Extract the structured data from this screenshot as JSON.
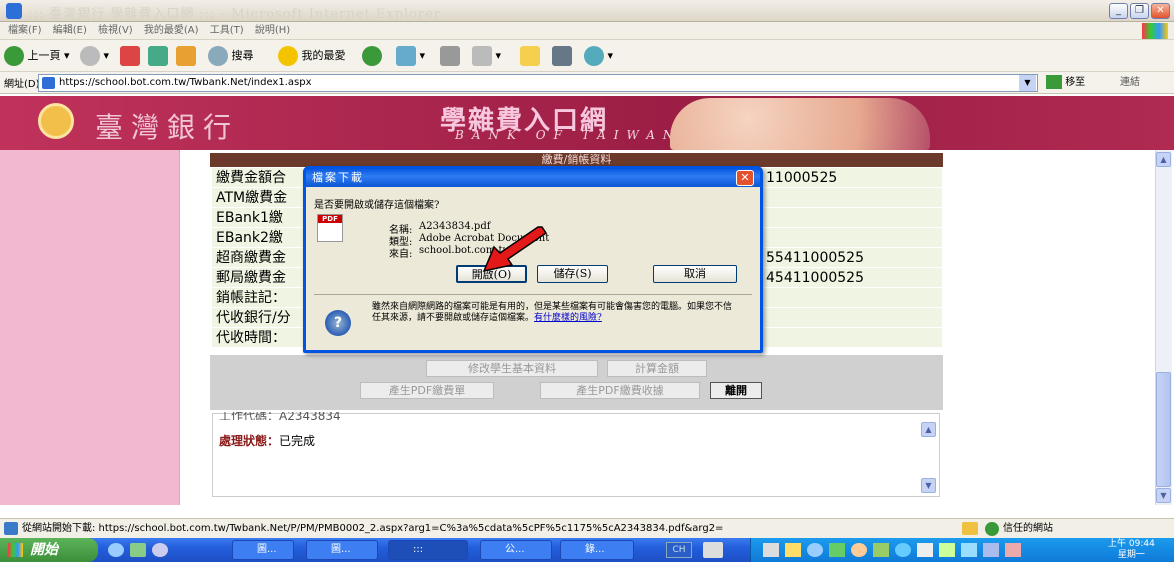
{
  "window": {
    "title": "::: 臺灣銀行 學雜費入口網 ::: - Microsoft Internet Explorer"
  },
  "menu": [
    "檔案(F)",
    "編輯(E)",
    "檢視(V)",
    "我的最愛(A)",
    "工具(T)",
    "說明(H)"
  ],
  "toolbar": {
    "back": "上一頁",
    "search": "搜尋",
    "favorites": "我的最愛"
  },
  "address": {
    "label": "網址(D)",
    "url": "https://school.bot.com.tw/Twbank.Net/index1.aspx",
    "go": "移至",
    "links": "連結"
  },
  "banner": {
    "bank_name": "臺灣銀行",
    "site_title": "學雜費入口網",
    "site_subtitle": "BANK OF TAIWAN"
  },
  "fee_panel": {
    "header": "繳費/銷帳資料",
    "rows": [
      {
        "label": "繳費金額合",
        "value": "11000525"
      },
      {
        "label": "ATM繳費金",
        "value": ""
      },
      {
        "label": "EBank1繳",
        "value": ""
      },
      {
        "label": "EBank2繳",
        "value": ""
      },
      {
        "label": "超商繳費金",
        "value": "55411000525"
      },
      {
        "label": "郵局繳費金",
        "value": "45411000525"
      },
      {
        "label": "銷帳註記：",
        "value": ""
      },
      {
        "label": "代收銀行/分",
        "value": ""
      },
      {
        "label": "代收時間：",
        "value": ""
      }
    ]
  },
  "buttons": {
    "edit_student": "修改學生基本資料",
    "calc_amount": "計算金額",
    "gen_pdf_bill": "產生PDF繳費單",
    "gen_pdf_receipt": "產生PDF繳費收據",
    "leave": "離開"
  },
  "status_box": {
    "line1": "工作代碼：A2343834",
    "line2_label": "處理狀態：",
    "line2_value": "已完成"
  },
  "dialog": {
    "title": "檔案下載",
    "question": "是否要開啟或儲存這個檔案?",
    "name_label": "名稱:",
    "name_value": "A2343834.pdf",
    "type_label": "類型:",
    "type_value": "Adobe Acrobat Document",
    "from_label": "來自:",
    "from_value": "school.bot.com.tw",
    "open_btn": "開啟(O)",
    "save_btn": "儲存(S)",
    "cancel_btn": "取消",
    "warning": "雖然來自網際網路的檔案可能是有用的，但是某些檔案有可能會傷害您的電腦。如果您不信任其來源，請不要開啟或儲存這個檔案。",
    "risk_link": "有什麼樣的風險?"
  },
  "statusbar": {
    "text": "從網站開始下載: https://school.bot.com.tw/Twbank.Net/P/PM/PMB0002_2.aspx?arg1=C%3a%5cdata%5cPF%5c1175%5cA2343834.pdf&arg2=",
    "zone": "信任的網站"
  },
  "taskbar": {
    "start": "開始",
    "tasks": [
      "圖...",
      "圖...",
      ":::",
      "公...",
      "錄..."
    ],
    "lang": "CH",
    "time": "上午 09:44",
    "day": "星期一"
  },
  "colors": {
    "banner": "#b02a52",
    "leftnav": "#f1b8cf",
    "dialog_title": "#0054e3",
    "fee_header": "#6b3a2a"
  }
}
